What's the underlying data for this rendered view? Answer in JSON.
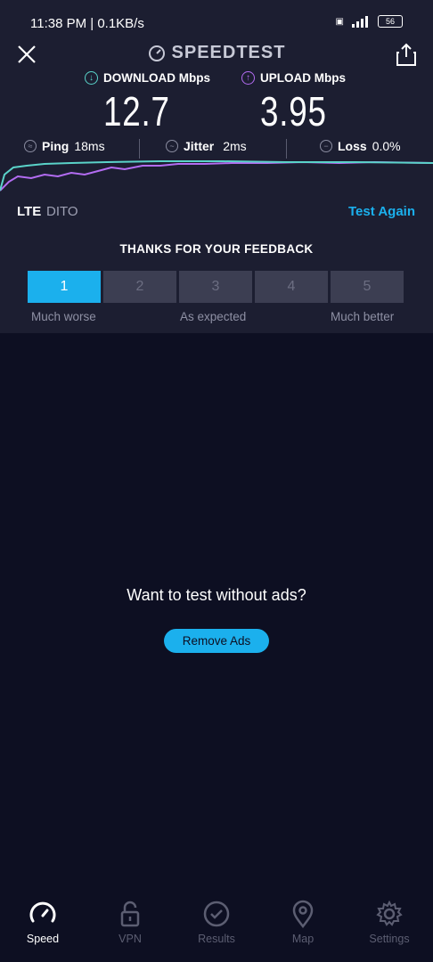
{
  "status_bar": {
    "time": "11:38 PM | 0.1KB/s",
    "battery": "56"
  },
  "header": {
    "brand": "SPEEDTEST",
    "close_icon": "close-icon",
    "share_icon": "share-icon"
  },
  "metrics": {
    "download_label": "DOWNLOAD Mbps",
    "download_value": "12.7",
    "upload_label": "UPLOAD Mbps",
    "upload_value": "3.95",
    "download_color": "#5ad3c9",
    "upload_color": "#b36cf2"
  },
  "stats": {
    "ping_label": "Ping",
    "ping_value": "18ms",
    "jitter_label": "Jitter",
    "jitter_value": "2ms",
    "loss_label": "Loss",
    "loss_value": "0.0%"
  },
  "network": {
    "type": "LTE",
    "provider": "DITO",
    "test_again": "Test Again"
  },
  "feedback": {
    "title": "THANKS FOR YOUR FEEDBACK",
    "ratings": [
      "1",
      "2",
      "3",
      "4",
      "5"
    ],
    "selected": "1",
    "label_low": "Much worse",
    "label_mid": "As expected",
    "label_high": "Much better"
  },
  "ads": {
    "prompt": "Want to test without ads?",
    "button": "Remove Ads"
  },
  "nav": {
    "speed": "Speed",
    "vpn": "VPN",
    "results": "Results",
    "map": "Map",
    "settings": "Settings"
  },
  "colors": {
    "accent": "#1bb0ed",
    "background": "#0d0f22",
    "panel": "#1c1e31"
  }
}
